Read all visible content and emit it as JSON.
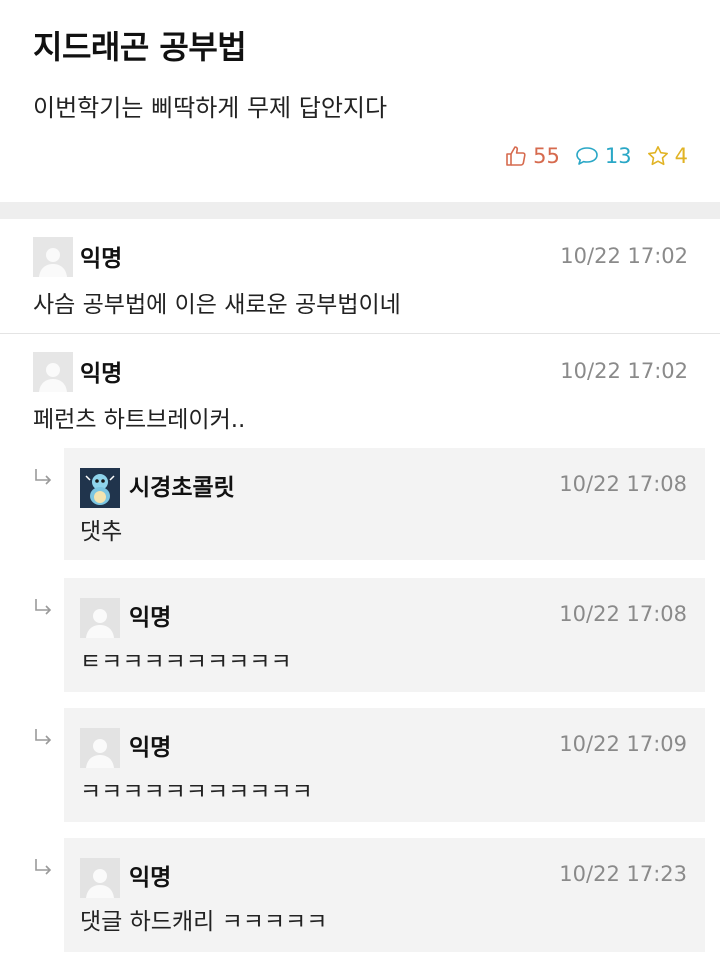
{
  "post": {
    "title": "지드래곤 공부법",
    "body": "이번학기는 삐딱하게 무제 답안지다",
    "likes": "55",
    "comments": "13",
    "scraps": "4",
    "colors": {
      "like": "#d66a4e",
      "comment": "#2aa7c6",
      "scrap": "#e1b324"
    }
  },
  "comments": [
    {
      "author": "익명",
      "time": "10/22 17:02",
      "text": "사슴 공부법에 이은 새로운 공부법이네"
    },
    {
      "author": "익명",
      "time": "10/22 17:02",
      "text": "페런츠 하트브레이커.."
    }
  ],
  "replies": [
    {
      "author": "시경초콜릿",
      "time": "10/22 17:08",
      "text": "댓추",
      "avatar": "squirtle-avatar"
    },
    {
      "author": "익명",
      "time": "10/22 17:08",
      "text": "ㅌㅋㅋㅋㅋㅋㅋㅋㅋㅋ",
      "avatar": "default-avatar"
    },
    {
      "author": "익명",
      "time": "10/22 17:09",
      "text": "ㅋㅋㅋㅋㅋㅋㅋㅋㅋㅋㅋ",
      "avatar": "default-avatar"
    },
    {
      "author": "익명",
      "time": "10/22 17:23",
      "text": "댓글 하드캐리 ㅋㅋㅋㅋㅋ",
      "avatar": "default-avatar"
    }
  ]
}
